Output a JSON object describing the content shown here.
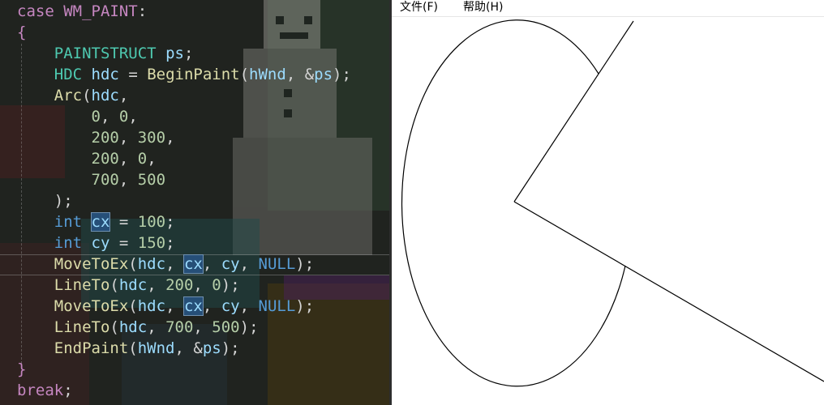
{
  "editor": {
    "lines": [
      [
        {
          "t": "case ",
          "c": "kw-purple"
        },
        {
          "t": "WM_PAINT",
          "c": "kw-purple"
        },
        {
          "t": ":",
          "c": "plain"
        }
      ],
      [
        {
          "t": "{",
          "c": "kw-purple"
        }
      ],
      [
        {
          "t": "    "
        },
        {
          "t": "PAINTSTRUCT",
          "c": "type"
        },
        {
          "t": " "
        },
        {
          "t": "ps",
          "c": "var"
        },
        {
          "t": ";",
          "c": "plain"
        }
      ],
      [
        {
          "t": "    "
        },
        {
          "t": "HDC",
          "c": "type"
        },
        {
          "t": " "
        },
        {
          "t": "hdc",
          "c": "var"
        },
        {
          "t": " = ",
          "c": "plain"
        },
        {
          "t": "BeginPaint",
          "c": "fn"
        },
        {
          "t": "(",
          "c": "plain"
        },
        {
          "t": "hWnd",
          "c": "var"
        },
        {
          "t": ", &",
          "c": "plain"
        },
        {
          "t": "ps",
          "c": "var"
        },
        {
          "t": ");",
          "c": "plain"
        }
      ],
      [
        {
          "t": "    "
        },
        {
          "t": "Arc",
          "c": "fn"
        },
        {
          "t": "(",
          "c": "plain"
        },
        {
          "t": "hdc",
          "c": "var"
        },
        {
          "t": ",",
          "c": "plain"
        }
      ],
      [
        {
          "t": "        "
        },
        {
          "t": "0",
          "c": "num"
        },
        {
          "t": ", ",
          "c": "plain"
        },
        {
          "t": "0",
          "c": "num"
        },
        {
          "t": ",",
          "c": "plain"
        }
      ],
      [
        {
          "t": "        "
        },
        {
          "t": "200",
          "c": "num"
        },
        {
          "t": ", ",
          "c": "plain"
        },
        {
          "t": "300",
          "c": "num"
        },
        {
          "t": ",",
          "c": "plain"
        }
      ],
      [
        {
          "t": "        "
        },
        {
          "t": "200",
          "c": "num"
        },
        {
          "t": ", ",
          "c": "plain"
        },
        {
          "t": "0",
          "c": "num"
        },
        {
          "t": ",",
          "c": "plain"
        }
      ],
      [
        {
          "t": "        "
        },
        {
          "t": "700",
          "c": "num"
        },
        {
          "t": ", ",
          "c": "plain"
        },
        {
          "t": "500",
          "c": "num"
        }
      ],
      [
        {
          "t": "    "
        },
        {
          "t": ");",
          "c": "plain"
        }
      ],
      [
        {
          "t": "    "
        },
        {
          "t": "int",
          "c": "kw-blue"
        },
        {
          "t": " "
        },
        {
          "t": "cx",
          "c": "var hl"
        },
        {
          "t": " = ",
          "c": "plain"
        },
        {
          "t": "100",
          "c": "num"
        },
        {
          "t": ";",
          "c": "plain"
        }
      ],
      [
        {
          "t": "    "
        },
        {
          "t": "int",
          "c": "kw-blue"
        },
        {
          "t": " "
        },
        {
          "t": "cy",
          "c": "var"
        },
        {
          "t": " = ",
          "c": "plain"
        },
        {
          "t": "150",
          "c": "num"
        },
        {
          "t": ";",
          "c": "plain"
        }
      ],
      [
        {
          "t": "    "
        },
        {
          "t": "MoveToEx",
          "c": "fn"
        },
        {
          "t": "(",
          "c": "plain"
        },
        {
          "t": "hdc",
          "c": "var"
        },
        {
          "t": ", ",
          "c": "plain"
        },
        {
          "t": "cx",
          "c": "var hl"
        },
        {
          "t": ", ",
          "c": "plain"
        },
        {
          "t": "cy",
          "c": "var"
        },
        {
          "t": ", ",
          "c": "plain"
        },
        {
          "t": "NULL",
          "c": "kw-blue"
        },
        {
          "t": ");",
          "c": "plain"
        }
      ],
      [
        {
          "t": "    "
        },
        {
          "t": "LineTo",
          "c": "fn"
        },
        {
          "t": "(",
          "c": "plain"
        },
        {
          "t": "hdc",
          "c": "var"
        },
        {
          "t": ", ",
          "c": "plain"
        },
        {
          "t": "200",
          "c": "num"
        },
        {
          "t": ", ",
          "c": "plain"
        },
        {
          "t": "0",
          "c": "num"
        },
        {
          "t": ");",
          "c": "plain"
        }
      ],
      [
        {
          "t": "    "
        },
        {
          "t": "MoveToEx",
          "c": "fn"
        },
        {
          "t": "(",
          "c": "plain"
        },
        {
          "t": "hdc",
          "c": "var"
        },
        {
          "t": ", ",
          "c": "plain"
        },
        {
          "t": "cx",
          "c": "var hl"
        },
        {
          "t": ", ",
          "c": "plain"
        },
        {
          "t": "cy",
          "c": "var"
        },
        {
          "t": ", ",
          "c": "plain"
        },
        {
          "t": "NULL",
          "c": "kw-blue"
        },
        {
          "t": ");",
          "c": "plain"
        }
      ],
      [
        {
          "t": "    "
        },
        {
          "t": "LineTo",
          "c": "fn"
        },
        {
          "t": "(",
          "c": "plain"
        },
        {
          "t": "hdc",
          "c": "var"
        },
        {
          "t": ", ",
          "c": "plain"
        },
        {
          "t": "700",
          "c": "num"
        },
        {
          "t": ", ",
          "c": "plain"
        },
        {
          "t": "500",
          "c": "num"
        },
        {
          "t": ");",
          "c": "plain"
        }
      ],
      [
        {
          "t": "    "
        },
        {
          "t": "EndPaint",
          "c": "fn"
        },
        {
          "t": "(",
          "c": "plain"
        },
        {
          "t": "hWnd",
          "c": "var"
        },
        {
          "t": ", &",
          "c": "plain"
        },
        {
          "t": "ps",
          "c": "var"
        },
        {
          "t": ");",
          "c": "plain"
        }
      ],
      [
        {
          "t": "}",
          "c": "kw-purple"
        }
      ],
      [
        {
          "t": "break",
          "c": "kw-purple"
        },
        {
          "t": ";",
          "c": "plain"
        }
      ]
    ],
    "colors": {
      "keyword": "#c586c0",
      "type": "#4ec9b0",
      "function": "#dcdcaa",
      "variable": "#9cdcfe",
      "number": "#b5cea8",
      "highlight": "#264f78"
    }
  },
  "app": {
    "menu": {
      "file": "文件(F)",
      "help": "帮助(H)"
    }
  }
}
